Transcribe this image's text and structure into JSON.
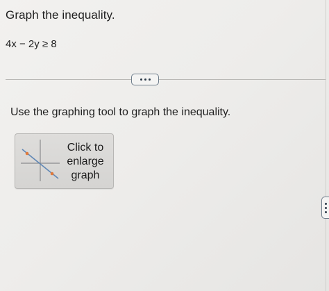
{
  "question": {
    "title": "Graph the inequality.",
    "equation": "4x − 2y ≥ 8"
  },
  "expand_button": {
    "icon": "ellipsis-icon"
  },
  "instruction": "Use the graphing tool to graph the inequality.",
  "graph_tool": {
    "label_lines": [
      "Click to",
      "enlarge",
      "graph"
    ],
    "thumbnail_icon": "graph-thumbnail-icon",
    "point_color": "#e07a3c",
    "line_color": "#5f87b5"
  },
  "side_tab": {
    "icon": "vertical-ellipsis-icon"
  }
}
